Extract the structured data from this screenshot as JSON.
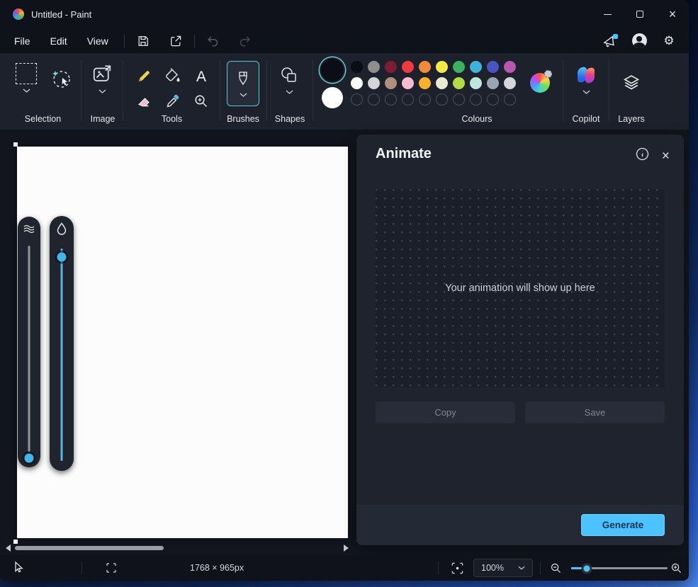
{
  "window": {
    "title": "Untitled - Paint"
  },
  "menu": {
    "file": "File",
    "edit": "Edit",
    "view": "View"
  },
  "toolbar": {
    "selection_label": "Selection",
    "image_label": "Image",
    "tools_label": "Tools",
    "brushes_label": "Brushes",
    "shapes_label": "Shapes",
    "colours_label": "Colours",
    "copilot_label": "Copilot",
    "layers_label": "Layers",
    "text_tool_glyph": "A",
    "foreground_colour": "#0b0e16",
    "background_colour": "#ffffff",
    "palette_row1": [
      "#0a0d16",
      "#8e8e8e",
      "#7e1c31",
      "#ee3a41",
      "#f08b3a",
      "#f4ea47",
      "#3bb260",
      "#3fb3dc",
      "#4a55c5",
      "#b459ab"
    ],
    "palette_row2": [
      "#ffffff",
      "#d3d5d8",
      "#b08f7c",
      "#f8bcd2",
      "#f8b02f",
      "#e9ebd1",
      "#b4da45",
      "#bfe6de",
      "#9aa5b3",
      "#d4d6de"
    ],
    "palette_empty_count": 10
  },
  "animate_panel": {
    "title": "Animate",
    "placeholder": "Your animation will show up here",
    "copy_label": "Copy",
    "save_label": "Save",
    "generate_label": "Generate"
  },
  "status_bar": {
    "canvas_size": "1768 × 965px",
    "zoom_value": "100%"
  },
  "colors": {
    "accent": "#4cc2ff",
    "slider_track": "#57b7e4",
    "toolbar_bg": "#1d212c",
    "panel_bg": "#1e232e"
  },
  "icons": {
    "gear": "⚙",
    "close": "×"
  }
}
